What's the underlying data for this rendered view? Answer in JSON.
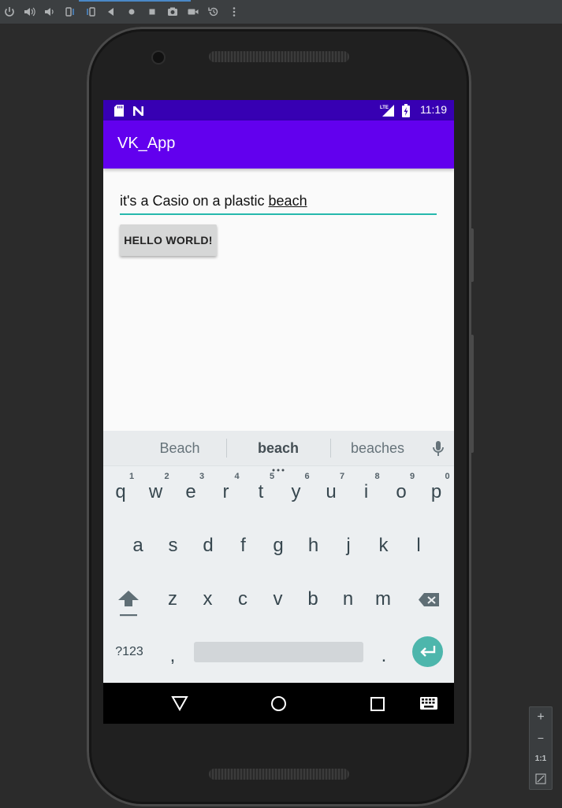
{
  "emulator": {
    "toolbar_icons": [
      "power-icon",
      "volume-up-icon",
      "volume-down-icon",
      "rotate-left-icon",
      "rotate-right-icon",
      "back-icon",
      "home-icon",
      "overview-icon",
      "screenshot-icon",
      "record-icon",
      "rewind-icon",
      "more-icon"
    ],
    "zoom": {
      "plus": "+",
      "minus": "−",
      "one_to_one": "1:1"
    }
  },
  "status_bar": {
    "time": "11:19",
    "network": "LTE",
    "background_color": "#3700b3"
  },
  "app_bar": {
    "title": "VK_App",
    "background_color": "#6200ee"
  },
  "edit_text": {
    "value_prefix": "it's a Casio on a plastic ",
    "value_composing": "beach",
    "underline_color": "#26b8ac"
  },
  "button": {
    "label": "HELLO WORLD!"
  },
  "keyboard": {
    "suggestions": [
      "Beach",
      "beach",
      "beaches"
    ],
    "row1": [
      "q",
      "w",
      "e",
      "r",
      "t",
      "y",
      "u",
      "i",
      "o",
      "p"
    ],
    "row1_hints": [
      "1",
      "2",
      "3",
      "4",
      "5",
      "6",
      "7",
      "8",
      "9",
      "0"
    ],
    "row2": [
      "a",
      "s",
      "d",
      "f",
      "g",
      "h",
      "j",
      "k",
      "l"
    ],
    "row3": [
      "z",
      "x",
      "c",
      "v",
      "b",
      "n",
      "m"
    ],
    "symbols_label": "?123",
    "comma": ",",
    "period": ".",
    "enter_color": "#4db6ac"
  },
  "nav_bar": {
    "icons": [
      "back-triangle-icon",
      "home-circle-icon",
      "recents-square-icon",
      "keyboard-switch-icon"
    ]
  }
}
